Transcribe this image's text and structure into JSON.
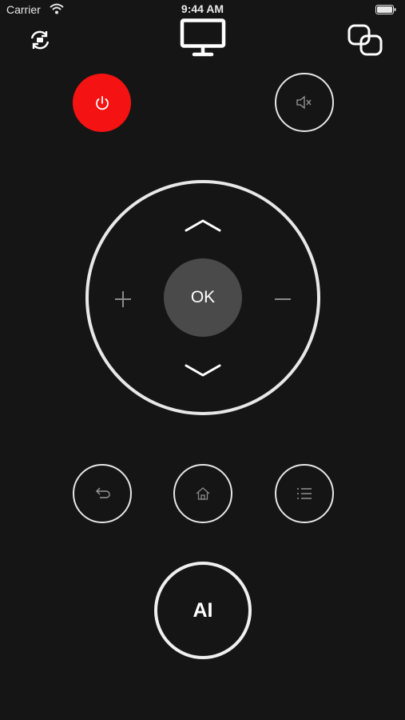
{
  "status_bar": {
    "carrier": "Carrier",
    "time": "9:44 AM"
  },
  "icons": {
    "top_left": "refresh-tv-icon",
    "top_center": "monitor-icon",
    "top_right": "link-icon",
    "power": "power-icon",
    "mute": "mute-icon",
    "up": "chevron-up-icon",
    "down": "chevron-down-icon",
    "plus": "plus-icon",
    "minus": "minus-icon",
    "back": "back-icon",
    "home": "home-icon",
    "menu": "menu-list-icon"
  },
  "colors": {
    "background": "#151515",
    "power": "#f41212",
    "ok_fill": "#4a4a4a",
    "outline": "#e8e8e8"
  },
  "dpad": {
    "ok_label": "OK",
    "plus_label": "+",
    "minus_label": "−"
  },
  "ai_button": {
    "label": "AI"
  }
}
